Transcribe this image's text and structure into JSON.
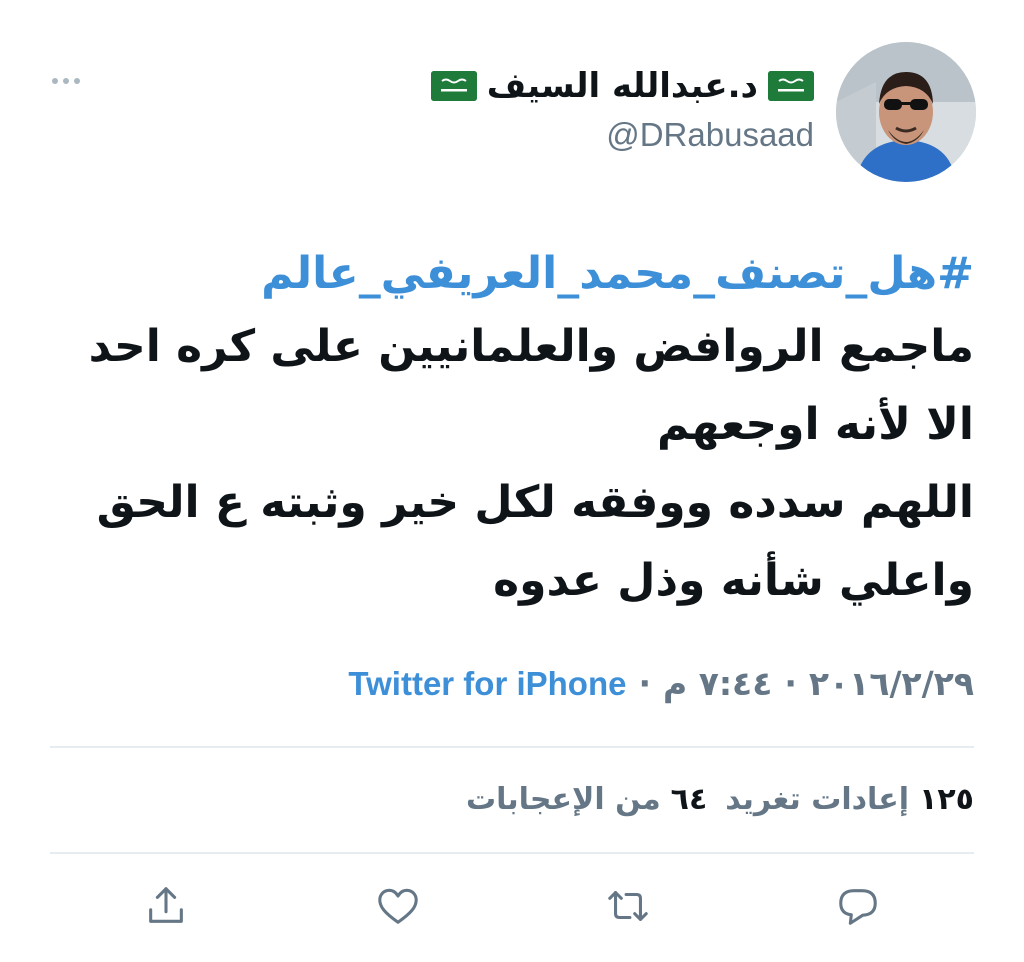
{
  "tweet": {
    "author": {
      "name": "د.عبدالله السيف",
      "handle": "@DRabusaad",
      "flag_icon": "saudi-flag-emoji"
    },
    "hashtag": "#هل_تصنف_محمد_العريفي_عالم",
    "lines": [
      "ماجمع الروافض والعلمانيين على كره احد",
      "الا لأنه اوجعهم",
      "اللهم سدده ووفقه لكل خير وثبته ع الحق",
      "واعلي شأنه وذل عدوه"
    ],
    "meta": {
      "date": "٢٠١٦/٢/٢٩",
      "separator": "·",
      "time": "٧:٤٤ م",
      "source": "Twitter for iPhone"
    },
    "stats": {
      "retweets_count": "١٢٥",
      "retweets_label": "إعادات تغريد",
      "likes_count": "٦٤",
      "likes_label": "من الإعجابات"
    },
    "actions": [
      "share-icon",
      "like-icon",
      "retweet-icon",
      "reply-icon"
    ]
  },
  "colors": {
    "link": "#3d8fd8",
    "secondary_text": "#657786",
    "primary_text": "#0f1419",
    "divider": "#e6ecf0",
    "flag_green": "#1e7b3a"
  }
}
